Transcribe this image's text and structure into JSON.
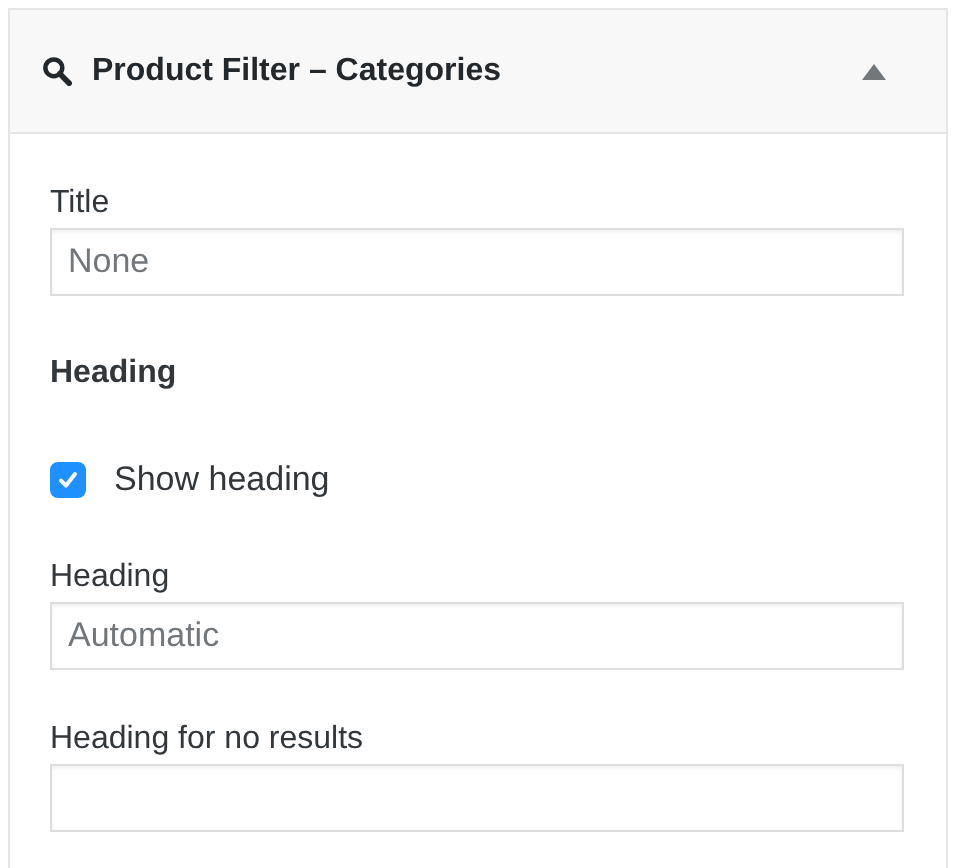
{
  "panel": {
    "title": "Product Filter – Categories",
    "expanded": true
  },
  "fields": [
    {
      "kind": "text",
      "label": "Title",
      "placeholder": "None"
    },
    {
      "kind": "section",
      "label": "Heading"
    },
    {
      "kind": "checkbox",
      "label": "Show heading",
      "checked": true
    },
    {
      "kind": "text",
      "label": "Heading",
      "placeholder": "Automatic"
    },
    {
      "kind": "text",
      "label": "Heading for no results"
    }
  ]
}
